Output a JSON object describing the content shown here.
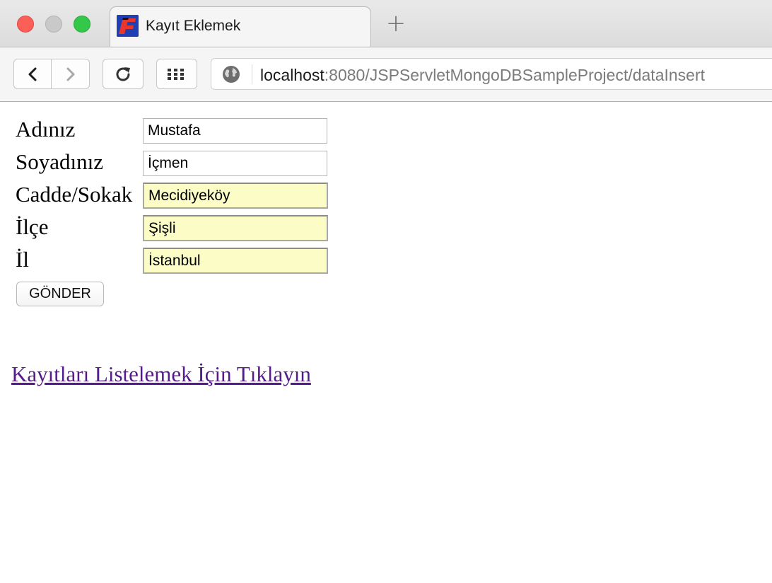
{
  "browser": {
    "tab_title": "Kayıt Eklemek",
    "new_tab_label": "+",
    "url_host": "localhost",
    "url_rest": ":8080/JSPServletMongoDBSampleProject/dataInsert"
  },
  "form": {
    "fields": [
      {
        "label": "Adınız",
        "value": "Mustafa",
        "autofilled": false
      },
      {
        "label": "Soyadınız",
        "value": "İçmen",
        "autofilled": false
      },
      {
        "label": "Cadde/Sokak",
        "value": "Mecidiyeköy",
        "autofilled": true
      },
      {
        "label": "İlçe",
        "value": "Şişli",
        "autofilled": true
      },
      {
        "label": "İl",
        "value": "İstanbul",
        "autofilled": true
      }
    ],
    "submit_label": "GÖNDER"
  },
  "list_link": "Kayıtları Listelemek İçin Tıklayın",
  "colors": {
    "autofill_background": "#fcfdc6",
    "visited_link": "#551a8b",
    "close_button": "#fc5f57",
    "maximize_button": "#34c84a"
  },
  "icons": [
    "back-arrow-icon",
    "forward-arrow-icon",
    "reload-icon",
    "apps-grid-icon",
    "globe-icon"
  ]
}
